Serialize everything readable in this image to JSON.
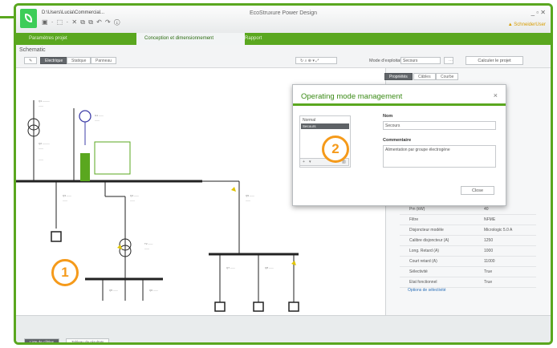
{
  "window": {
    "file_path": "D:\\Users\\Lucia\\Commercial...",
    "title": "EcoStruxure Power Design",
    "controls": "_ ▫ ✕",
    "user": "▲ SchneiderUser",
    "quick_toolbar": "▣ · ⬚ · ✕ ⧉ ⧉ ↶ ↷ ⓘ"
  },
  "ribbon": {
    "tabs": [
      "Paramètres projet",
      "Conception et dimensionnement",
      "Rapport"
    ],
    "active_index": 1
  },
  "toolbar": {
    "section_title": "Schematic",
    "view_buttons": [
      "Electrique",
      "Statique",
      "Panneau"
    ],
    "mode_label": "Mode d'exploitation",
    "mode_value": "Secours",
    "calculate_label": "Calculer le projet"
  },
  "side_panel": {
    "tabs": [
      "Propriétés",
      "Câbles",
      "Courbe"
    ],
    "properties": [
      {
        "label": "Pm (kW)",
        "value": "40"
      },
      {
        "label": "Filtre",
        "value": "NFME"
      },
      {
        "label": "Disjoncteur modèle",
        "value": "Micrologic 5.0 A"
      },
      {
        "label": "Calibre disjoncteur (A)",
        "value": "1250"
      },
      {
        "label": "Long. Retard (A)",
        "value": "1000"
      },
      {
        "label": "Court retard (A)",
        "value": "11000"
      },
      {
        "label": "Sélectivité",
        "value": "True"
      },
      {
        "label": "Etat fonctionnel",
        "value": "True"
      }
    ],
    "link": "Options de sélectivité"
  },
  "dialog": {
    "title": "Operating mode management",
    "close_glyph": "×",
    "list_header": "Normal",
    "list_items": [
      "Secours"
    ],
    "name_label": "Nom",
    "name_value": "Secours",
    "comment_label": "Commentaire",
    "comment_value": "Alimentation par groupe électrogène",
    "close_button": "Close"
  },
  "bottom_tabs": [
    "Liste de câbles",
    "Tableau de résultats"
  ],
  "callouts": [
    "1",
    "2"
  ],
  "colors": {
    "accent": "#5aa71f",
    "callout": "#f59a1a",
    "generator": "#3e3ea8",
    "breaker": "#e1c400"
  }
}
